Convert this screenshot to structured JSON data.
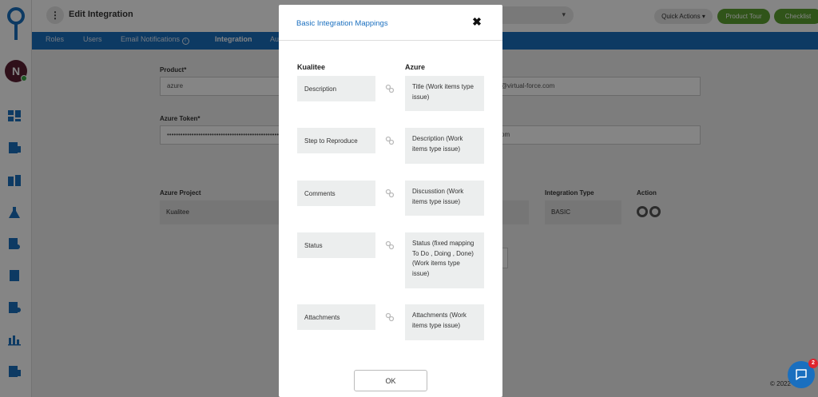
{
  "header": {
    "title": "Edit Integration",
    "quick_actions_label": "Quick Actions ▾",
    "product_tour_label": "Product Tour",
    "checklist_label": "Checklist"
  },
  "user": {
    "initial": "N"
  },
  "sidebar": {
    "icons": [
      "dashboard-icon",
      "test-cases-icon",
      "projects-icon",
      "test-lab-icon",
      "reports-icon",
      "requirements-icon",
      "defects-icon",
      "analytics-icon",
      "settings-icon"
    ]
  },
  "tabs": [
    {
      "label": "Roles"
    },
    {
      "label": "Users"
    },
    {
      "label": "Email Notifications"
    },
    {
      "label": "Integration"
    },
    {
      "label": "Au"
    }
  ],
  "form": {
    "product_label": "Product*",
    "product_value": "azure",
    "email_partial": "@virtual-force.com",
    "token_label": "Azure Token*",
    "token_value": "••••••••••••••••••••••••••••••••••••••••••••••••••••••",
    "url_partial": "om"
  },
  "table": {
    "headers": {
      "project": "Azure Project",
      "integration_type": "Integration Type",
      "action": "Action"
    },
    "row": {
      "project": "Kualitee",
      "integration_type": "BASIC"
    }
  },
  "footer": {
    "copyright": "© 2022"
  },
  "modal": {
    "title": "Basic Integration Mappings",
    "left_heading": "Kualitee",
    "right_heading": "Azure",
    "mappings": [
      {
        "kualitee": "Description",
        "azure": "Title (Work items type issue)"
      },
      {
        "kualitee": "Step to Reproduce",
        "azure": "Description (Work items type issue)"
      },
      {
        "kualitee": "Comments",
        "azure": "Discusstion (Work items type issue)"
      },
      {
        "kualitee": "Status",
        "azure": "Status (fixed mapping To Do , Doing , Done) (Work items type issue)"
      },
      {
        "kualitee": "Attachments",
        "azure": "Attachments (Work items type issue)"
      }
    ],
    "ok_label": "OK"
  },
  "chat": {
    "badge_count": "2"
  },
  "colors": {
    "brand_blue": "#1a6fbf",
    "green": "#5ca131",
    "overlay": "rgba(0,0,0,0.48)"
  }
}
